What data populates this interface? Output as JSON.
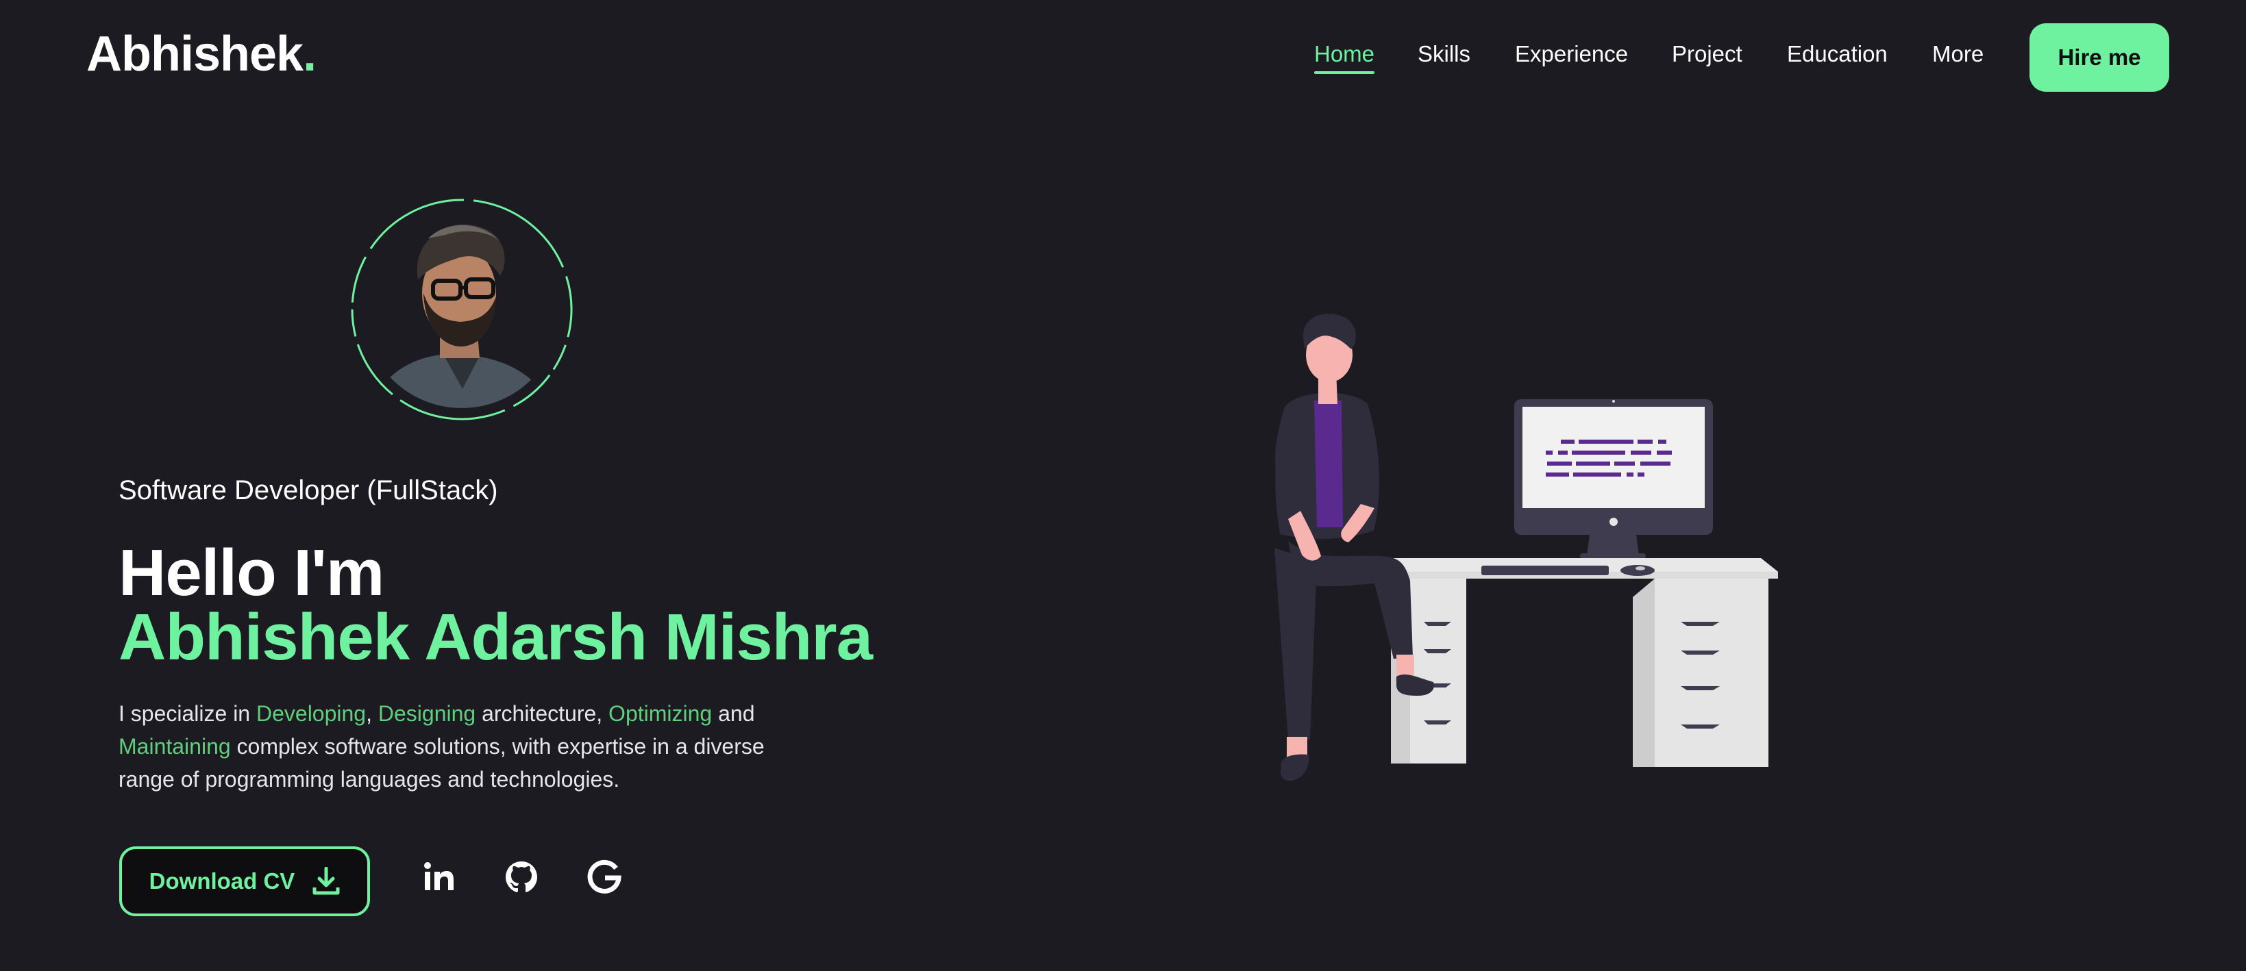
{
  "brand": {
    "name": "Abhishek",
    "dot": ".",
    "accent_color": "#6ef2a0"
  },
  "nav": {
    "items": [
      {
        "label": "Home",
        "active": true
      },
      {
        "label": "Skills"
      },
      {
        "label": "Experience"
      },
      {
        "label": "Project"
      },
      {
        "label": "Education"
      },
      {
        "label": "More"
      }
    ],
    "cta_label": "Hire me"
  },
  "hero": {
    "role": "Software Developer (FullStack)",
    "greeting": "Hello I'm",
    "name": "Abhishek Adarsh Mishra",
    "description": {
      "p1": "I specialize in ",
      "h1": "Developing",
      "p2": ", ",
      "h2": "Designing",
      "p3": " architecture, ",
      "h3": "Optimizing",
      "p4": " and ",
      "h4": "Maintaining",
      "p5": " complex software solutions, with expertise in a diverse range of programming languages and technologies."
    },
    "download_label": "Download CV",
    "icons": {
      "download": "download-icon",
      "socials": [
        "linkedin-icon",
        "github-icon",
        "google-icon"
      ]
    }
  },
  "colors": {
    "background": "#1c1b22",
    "accent": "#6ef2a0",
    "highlight_text": "#5fcf7e"
  }
}
